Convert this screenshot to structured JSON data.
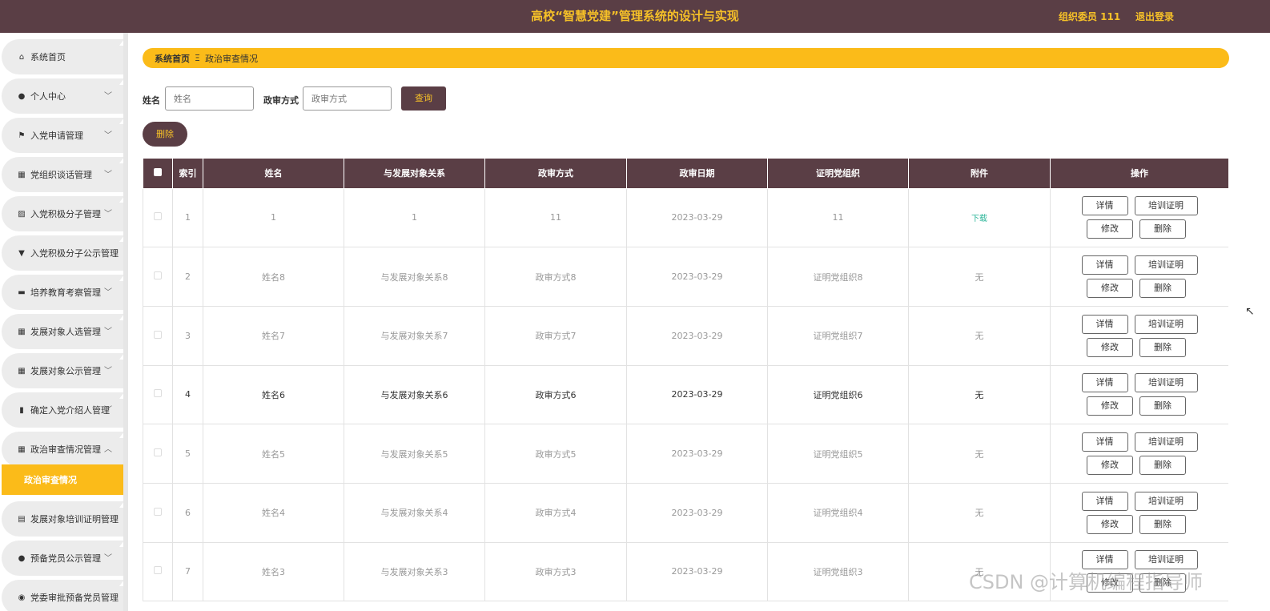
{
  "header": {
    "title": "高校“智慧党建”管理系统的设计与实现",
    "user": "组织委员 111",
    "logout": "退出登录"
  },
  "sidebar": {
    "items": [
      {
        "label": "系统首页",
        "icon": "home-icon",
        "glyph": "⌂",
        "chevron": ""
      },
      {
        "label": "个人中心",
        "icon": "user-icon",
        "glyph": "●",
        "chevron": "﹀"
      },
      {
        "label": "入党申请管理",
        "icon": "flag-icon",
        "glyph": "⚑",
        "chevron": "﹀"
      },
      {
        "label": "党组织谈话管理",
        "icon": "grid-icon",
        "glyph": "▦",
        "chevron": "﹀"
      },
      {
        "label": "入党积极分子管理",
        "icon": "chart-icon",
        "glyph": "▨",
        "chevron": "﹀"
      },
      {
        "label": "入党积极分子公示管理",
        "icon": "pin-icon",
        "glyph": "▼",
        "chevron": ""
      },
      {
        "label": "培养教育考察管理",
        "icon": "briefcase-icon",
        "glyph": "▬",
        "chevron": "﹀"
      },
      {
        "label": "发展对象人选管理",
        "icon": "grid-icon",
        "glyph": "▦",
        "chevron": "﹀"
      },
      {
        "label": "发展对象公示管理",
        "icon": "grid-icon",
        "glyph": "▦",
        "chevron": "﹀"
      },
      {
        "label": "确定入党介绍人管理",
        "icon": "bar-chart-icon",
        "glyph": "▮",
        "chevron": "﹀"
      },
      {
        "label": "政治审查情况管理",
        "icon": "grid-icon",
        "glyph": "▦",
        "chevron": "︿"
      },
      {
        "label": "发展对象培训证明管理",
        "icon": "document-icon",
        "glyph": "▤",
        "chevron": ""
      },
      {
        "label": "预备党员公示管理",
        "icon": "user-icon",
        "glyph": "●",
        "chevron": "﹀"
      },
      {
        "label": "党委审批预备党员管理",
        "icon": "bulb-icon",
        "glyph": "◉",
        "chevron": ""
      }
    ],
    "submenu_active": "政治审查情况"
  },
  "breadcrumb": {
    "home": "系统首页",
    "separator": "Ξ",
    "current": "政治审查情况"
  },
  "search": {
    "name_label": "姓名",
    "name_placeholder": "姓名",
    "method_label": "政审方式",
    "method_placeholder": "政审方式",
    "query_button": "查询"
  },
  "actions": {
    "delete_button": "删除"
  },
  "table": {
    "headers": [
      "",
      "索引",
      "姓名",
      "与发展对象关系",
      "政审方式",
      "政审日期",
      "证明党组织",
      "附件",
      "操作"
    ],
    "rows": [
      {
        "index": "1",
        "name": "1",
        "relation": "1",
        "method": "11",
        "date": "2023-03-29",
        "org": "11",
        "attachment": "下载",
        "has_file": true
      },
      {
        "index": "2",
        "name": "姓名8",
        "relation": "与发展对象关系8",
        "method": "政审方式8",
        "date": "2023-03-29",
        "org": "证明党组织8",
        "attachment": "无",
        "has_file": false
      },
      {
        "index": "3",
        "name": "姓名7",
        "relation": "与发展对象关系7",
        "method": "政审方式7",
        "date": "2023-03-29",
        "org": "证明党组织7",
        "attachment": "无",
        "has_file": false
      },
      {
        "index": "4",
        "name": "姓名6",
        "relation": "与发展对象关系6",
        "method": "政审方式6",
        "date": "2023-03-29",
        "org": "证明党组织6",
        "attachment": "无",
        "has_file": false
      },
      {
        "index": "5",
        "name": "姓名5",
        "relation": "与发展对象关系5",
        "method": "政审方式5",
        "date": "2023-03-29",
        "org": "证明党组织5",
        "attachment": "无",
        "has_file": false
      },
      {
        "index": "6",
        "name": "姓名4",
        "relation": "与发展对象关系4",
        "method": "政审方式4",
        "date": "2023-03-29",
        "org": "证明党组织4",
        "attachment": "无",
        "has_file": false
      },
      {
        "index": "7",
        "name": "姓名3",
        "relation": "与发展对象关系3",
        "method": "政审方式3",
        "date": "2023-03-29",
        "org": "证明党组织3",
        "attachment": "无",
        "has_file": false
      }
    ],
    "hovered_row": 3,
    "op_buttons": {
      "detail": "详情",
      "certificate": "培训证明",
      "edit": "修改",
      "delete": "删除"
    }
  },
  "watermark": "CSDN @计算机编程指导师",
  "colors": {
    "header_bg": "#5a3e45",
    "accent": "#fbbb19",
    "title_text": "#f5c028",
    "download_link": "#2bb598"
  }
}
